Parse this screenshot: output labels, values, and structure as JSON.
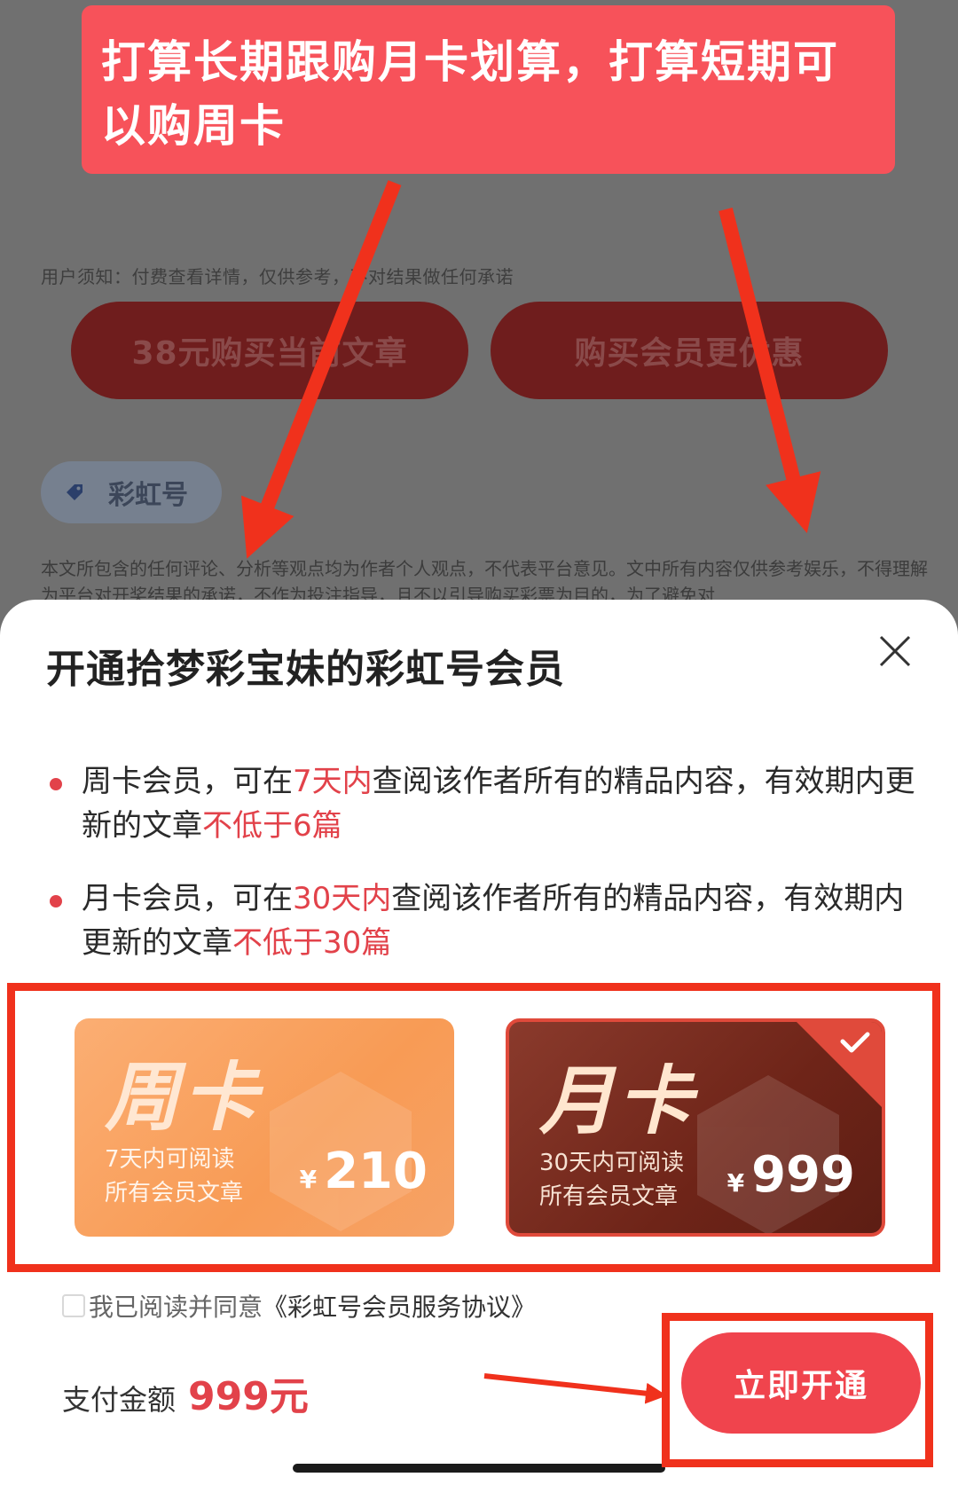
{
  "annotation": {
    "text": "打算长期跟购月卡划算，打算短期可以购周卡"
  },
  "background": {
    "notice": "用户须知：付费查看详情，仅供参考，不对结果做任何承诺",
    "buy_article_label": "38元购买当前文章",
    "buy_member_label": "购买会员更优惠",
    "tag_label": "彩虹号",
    "disclaimer": "本文所包含的任何评论、分析等观点均为作者个人观点，不代表平台意见。文中所有内容仅供参考娱乐，不得理解为平台对开奖结果的承诺，不作为投注指导，且不以引导购买彩票为目的，为了避免对"
  },
  "sheet": {
    "title": "开通拾梦彩宝妹的彩虹号会员",
    "benefits": [
      {
        "a": "周卡会员，可在",
        "b": "7天内",
        "c": "查阅该作者所有的精品内容，有效期内更新的文章",
        "d": "不低于6篇"
      },
      {
        "a": "月卡会员，可在",
        "b": "30天内",
        "c": "查阅该作者所有的精品内容，有效期内更新的文章",
        "d": "不低于30篇"
      }
    ],
    "cards": [
      {
        "title": "周卡",
        "desc1": "7天内可阅读",
        "desc2": "所有会员文章",
        "currency": "¥",
        "price": "210",
        "selected": false
      },
      {
        "title": "月卡",
        "desc1": "30天内可阅读",
        "desc2": "所有会员文章",
        "currency": "¥",
        "price": "999",
        "selected": true
      }
    ],
    "agreement": {
      "prefix": "我已阅读并同意",
      "link": "《彩虹号会员服务协议》",
      "checked": false
    },
    "pay_label": "支付金额",
    "pay_amount": "999元",
    "open_button": "立即开通"
  },
  "colors": {
    "accent": "#f0444d",
    "annotation_red": "#f0311c",
    "highlight": "#e2424a"
  }
}
